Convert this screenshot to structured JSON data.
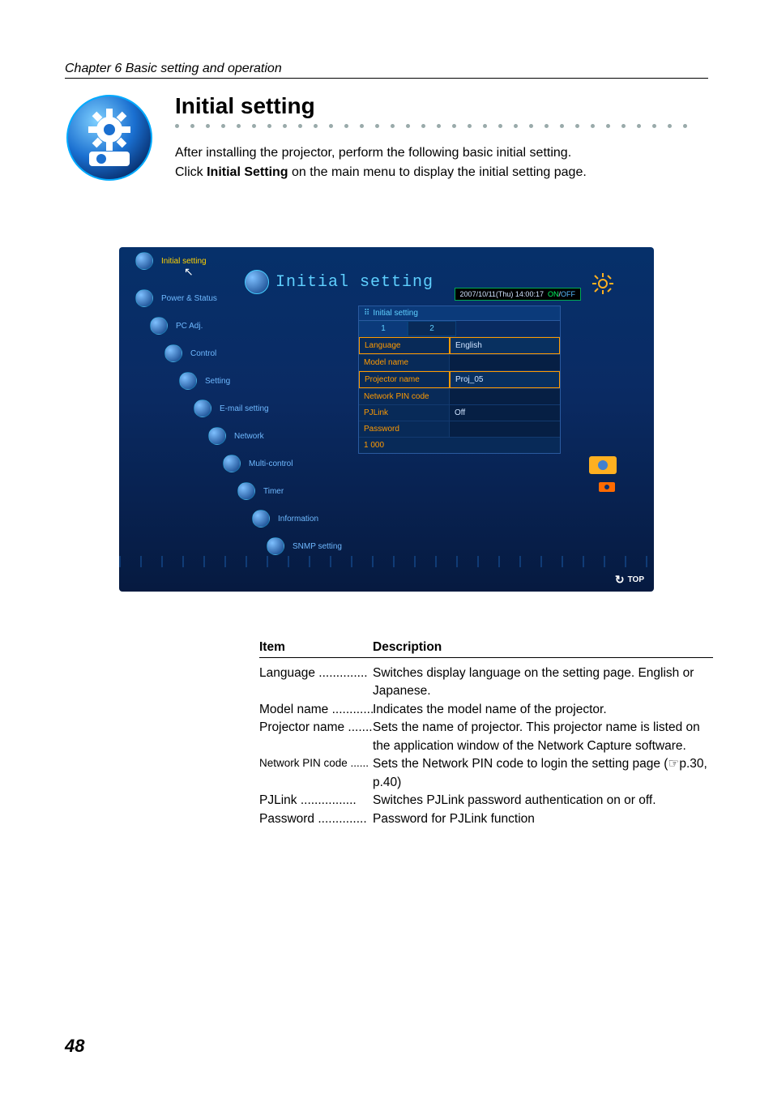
{
  "chapter": "Chapter 6 Basic setting and operation",
  "title": "Initial setting",
  "intro_line1": "After installing the projector, perform the following basic initial setting.",
  "intro_line2a": "Click ",
  "intro_line2b": "Initial Setting",
  "intro_line2c": " on the main menu to display the initial setting page.",
  "page_number": "48",
  "screenshot": {
    "menu": {
      "initial_setting": "Initial setting",
      "power_status": "Power & Status",
      "pc_adj": "PC Adj.",
      "control": "Control",
      "setting": "Setting",
      "email_setting": "E-mail setting",
      "network": "Network",
      "multi_control": "Multi-control",
      "timer": "Timer",
      "information": "Information",
      "snmp_setting": "SNMP setting"
    },
    "title_text": "Initial setting",
    "datetime": "2007/10/11(Thu)  14:00:17",
    "on": "ON",
    "off": "OFF",
    "panel_head": "Initial setting",
    "tab1": "1",
    "tab2": "2",
    "rows": {
      "language": {
        "k": "Language",
        "v": "English"
      },
      "model": {
        "k": "Model name",
        "v": ""
      },
      "projector": {
        "k": "Projector name",
        "v": "Proj_05"
      },
      "pin": {
        "k": "Network PIN code",
        "v": ""
      },
      "pjlink": {
        "k": "PJLink",
        "v": "Off"
      },
      "password": {
        "k": "Password",
        "v": ""
      }
    },
    "foot": "1 000",
    "top": "TOP"
  },
  "table": {
    "head_item": "Item",
    "head_desc": "Description",
    "rows": [
      {
        "item": "Language",
        "item_class": "",
        "desc": "Switches display language on the setting page. English or Japanese."
      },
      {
        "item": "Model name",
        "item_class": "",
        "desc": "Indicates the model name of the projector."
      },
      {
        "item": "Projector name",
        "item_class": "",
        "desc": "Sets the name of projector.  This projector name is listed on the application window of the Network Capture software."
      },
      {
        "item": "Network PIN code",
        "item_class": "small",
        "desc": "Sets the Network PIN code to login the setting page (☞p.30, p.40)"
      },
      {
        "item": "PJLink",
        "item_class": "",
        "desc": "Switches PJLink password authentication on or off."
      },
      {
        "item": "Password",
        "item_class": "",
        "desc": "Password for PJLink function"
      }
    ]
  }
}
